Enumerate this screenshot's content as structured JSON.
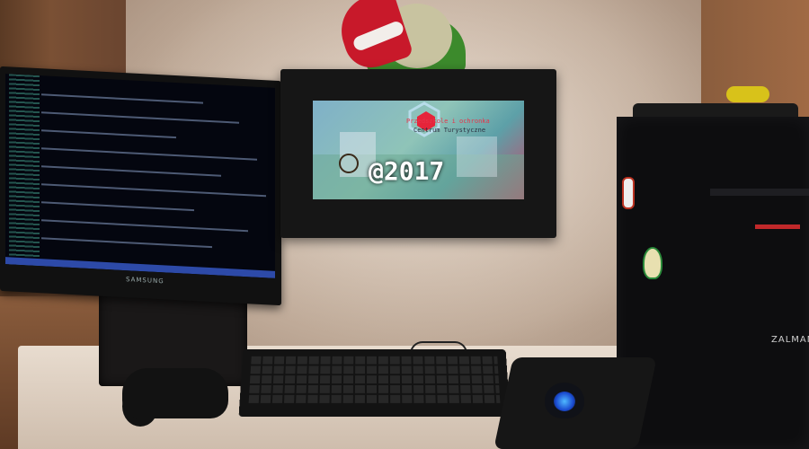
{
  "scene": {
    "left_monitor": {
      "brand": "SAMSUNG"
    },
    "center_monitor": {
      "screen_text_main": "@2017",
      "screen_text_sub_1": "Przedszkole i ochronka",
      "screen_text_sub_2": "Centrum Turystyczne"
    },
    "tower": {
      "brand": "ZALMAN"
    }
  }
}
